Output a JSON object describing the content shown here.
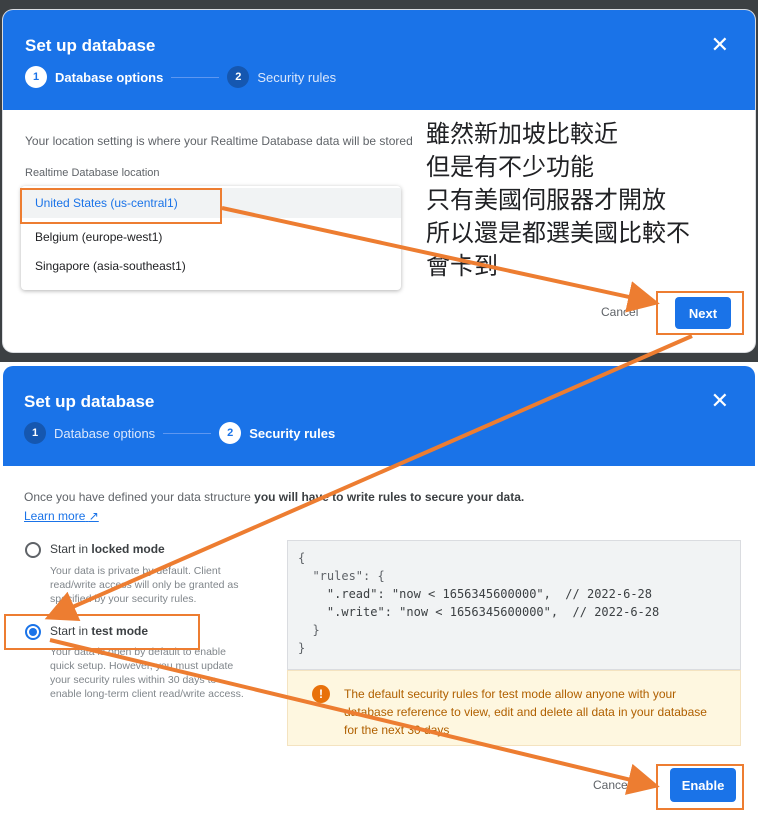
{
  "colors": {
    "accent": "#1a73e8",
    "annotation": "#ed7d31",
    "warning": "#e8710a"
  },
  "dialog1": {
    "title": "Set up database",
    "close_icon": "close-icon",
    "steps": [
      {
        "number": "1",
        "label": "Database options"
      },
      {
        "number": "2",
        "label": "Security rules"
      }
    ],
    "description": "Your location setting is where your Realtime Database data will be stored",
    "location_label": "Realtime Database location",
    "options": [
      "United States (us-central1)",
      "Belgium (europe-west1)",
      "Singapore (asia-southeast1)"
    ],
    "selected_option": "United States (us-central1)",
    "cancel_label": "Cancel",
    "next_label": "Next"
  },
  "annotation": {
    "lines": [
      "雖然新加坡比較近",
      "但是有不少功能",
      "只有美國伺服器才開放",
      "所以還是都選美國比較不",
      "會卡到"
    ]
  },
  "dialog2": {
    "title": "Set up database",
    "close_icon": "close-icon",
    "steps": [
      {
        "number": "1",
        "label": "Database options"
      },
      {
        "number": "2",
        "label": "Security rules"
      }
    ],
    "intro_plain": "Once you have defined your data structure ",
    "intro_bold": "you will have to write rules to secure your data.",
    "learn_more": "Learn more",
    "locked_prefix": "Start in ",
    "locked_mode": "locked mode",
    "locked_desc": "Your data is private by default. Client read/write access will only be granted as specified by your security rules.",
    "test_prefix": "Start in ",
    "test_mode": "test mode",
    "test_desc": "Your data is open by default to enable quick setup. However, you must update your security rules within 30 days to enable long-term client read/write access.",
    "selected_mode": "test mode",
    "code_lines": [
      "{",
      "  \"rules\": {",
      "    \".read\": \"now < 1656345600000\",  // 2022-6-28",
      "    \".write\": \"now < 1656345600000\",  // 2022-6-28",
      "  }",
      "}"
    ],
    "warning": "The default security rules for test mode allow anyone with your database reference to view, edit and delete all data in your database for the next 30 days",
    "cancel_label": "Cancel",
    "enable_label": "Enable"
  }
}
